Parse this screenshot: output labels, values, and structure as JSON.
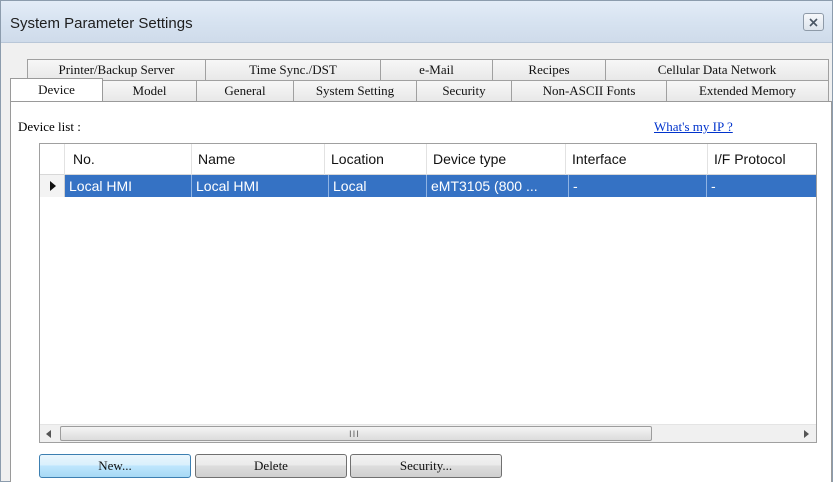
{
  "window": {
    "title": "System Parameter Settings"
  },
  "tabs": {
    "back_row": [
      {
        "label": "Printer/Backup Server"
      },
      {
        "label": "Time Sync./DST"
      },
      {
        "label": "e-Mail"
      },
      {
        "label": "Recipes"
      },
      {
        "label": "Cellular Data Network"
      }
    ],
    "front_row": [
      {
        "label": "Device",
        "active": true
      },
      {
        "label": "Model"
      },
      {
        "label": "General"
      },
      {
        "label": "System Setting"
      },
      {
        "label": "Security"
      },
      {
        "label": "Non-ASCII Fonts"
      },
      {
        "label": "Extended Memory"
      }
    ]
  },
  "device_panel": {
    "list_label": "Device list :",
    "whats_my_ip": "What's my IP ?",
    "columns": [
      "No.",
      "Name",
      "Location",
      "Device type",
      "Interface",
      "I/F Protocol"
    ],
    "rows": [
      {
        "selected": true,
        "cells": [
          "Local HMI",
          "Local HMI",
          "Local",
          "eMT3105 (800 ...",
          "-",
          "-"
        ]
      }
    ],
    "scrollbar_grip": "III"
  },
  "buttons": {
    "new": "New...",
    "delete": "Delete",
    "security": "Security..."
  },
  "colors": {
    "selection": "#3572c4",
    "link": "#0033cc"
  }
}
